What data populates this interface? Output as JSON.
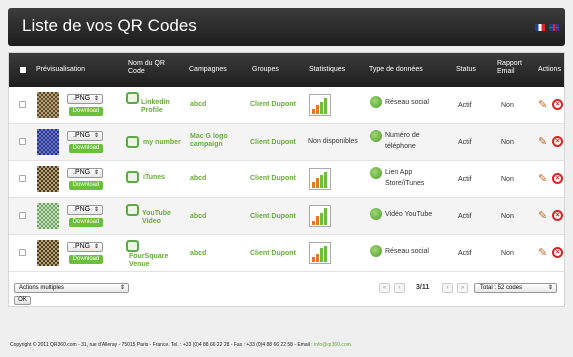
{
  "header": {
    "title": "Liste de vos QR Codes"
  },
  "columns": {
    "preview": "Prévisualisation",
    "name": "Nom du QR Code",
    "campaigns": "Campagnes",
    "groups": "Groupes",
    "stats": "Statistiques",
    "data_type": "Type de données",
    "status": "Status",
    "report": "Rapport Email",
    "actions": "Actions"
  },
  "rows": [
    {
      "format": ".PNG",
      "download": "Download",
      "name": "Linkedin Profile",
      "campaign": "abcd",
      "group": "Client Dupont",
      "stats": "",
      "type": "Réseau social",
      "status": "Actif",
      "report": "Non"
    },
    {
      "format": ".PNG",
      "download": "Download",
      "name": "my number",
      "campaign": "Mac G logo campaign",
      "group": "Client Dupont",
      "stats": "Non disponibles",
      "type": "Numéro de téléphone",
      "status": "Actif",
      "report": "Non"
    },
    {
      "format": ".PNG",
      "download": "Download",
      "name": "iTunes",
      "campaign": "abcd",
      "group": "Client Dupont",
      "stats": "",
      "type": "Lien App Store/iTunes",
      "status": "Actif",
      "report": "Non"
    },
    {
      "format": ".PNG",
      "download": "Download",
      "name": "YouTube Video",
      "campaign": "abcd",
      "group": "Client Dupont",
      "stats": "",
      "type": "Vidéo YouTube",
      "status": "Actif",
      "report": "Non"
    },
    {
      "format": ".PNG",
      "download": "Download",
      "name": "FourSquare Venue",
      "campaign": "abcd",
      "group": "Client Dupont",
      "stats": "",
      "type": "Réseau social",
      "status": "Actif",
      "report": "Non"
    }
  ],
  "bulk": {
    "select_value": "Actions multiples",
    "ok_label": "OK"
  },
  "pagination": {
    "first": "«",
    "prev": "‹",
    "info": "3/11",
    "next": "›",
    "last": "»",
    "total": "Total : 52 codes"
  },
  "footer": {
    "copyright": "Copyright © 2011 QR360.com - 31, rue d'Alleray - 75015 Paris - France. Tel. : +33 (0)4 88 66 22 28 - Fax : +33 (0)4 88 66 22 58 - Email : ",
    "email": "info@qr360.com."
  },
  "colors": {
    "accent": "#6aaa3c",
    "header_bg": "#2b2b2b",
    "delete": "#d42525"
  },
  "icons": [
    "flag-fr-icon",
    "flag-uk-icon",
    "qr-code-icon",
    "document-icon",
    "bar-chart-icon",
    "globe-icon",
    "pencil-icon",
    "delete-icon",
    "chevron-icon"
  ]
}
